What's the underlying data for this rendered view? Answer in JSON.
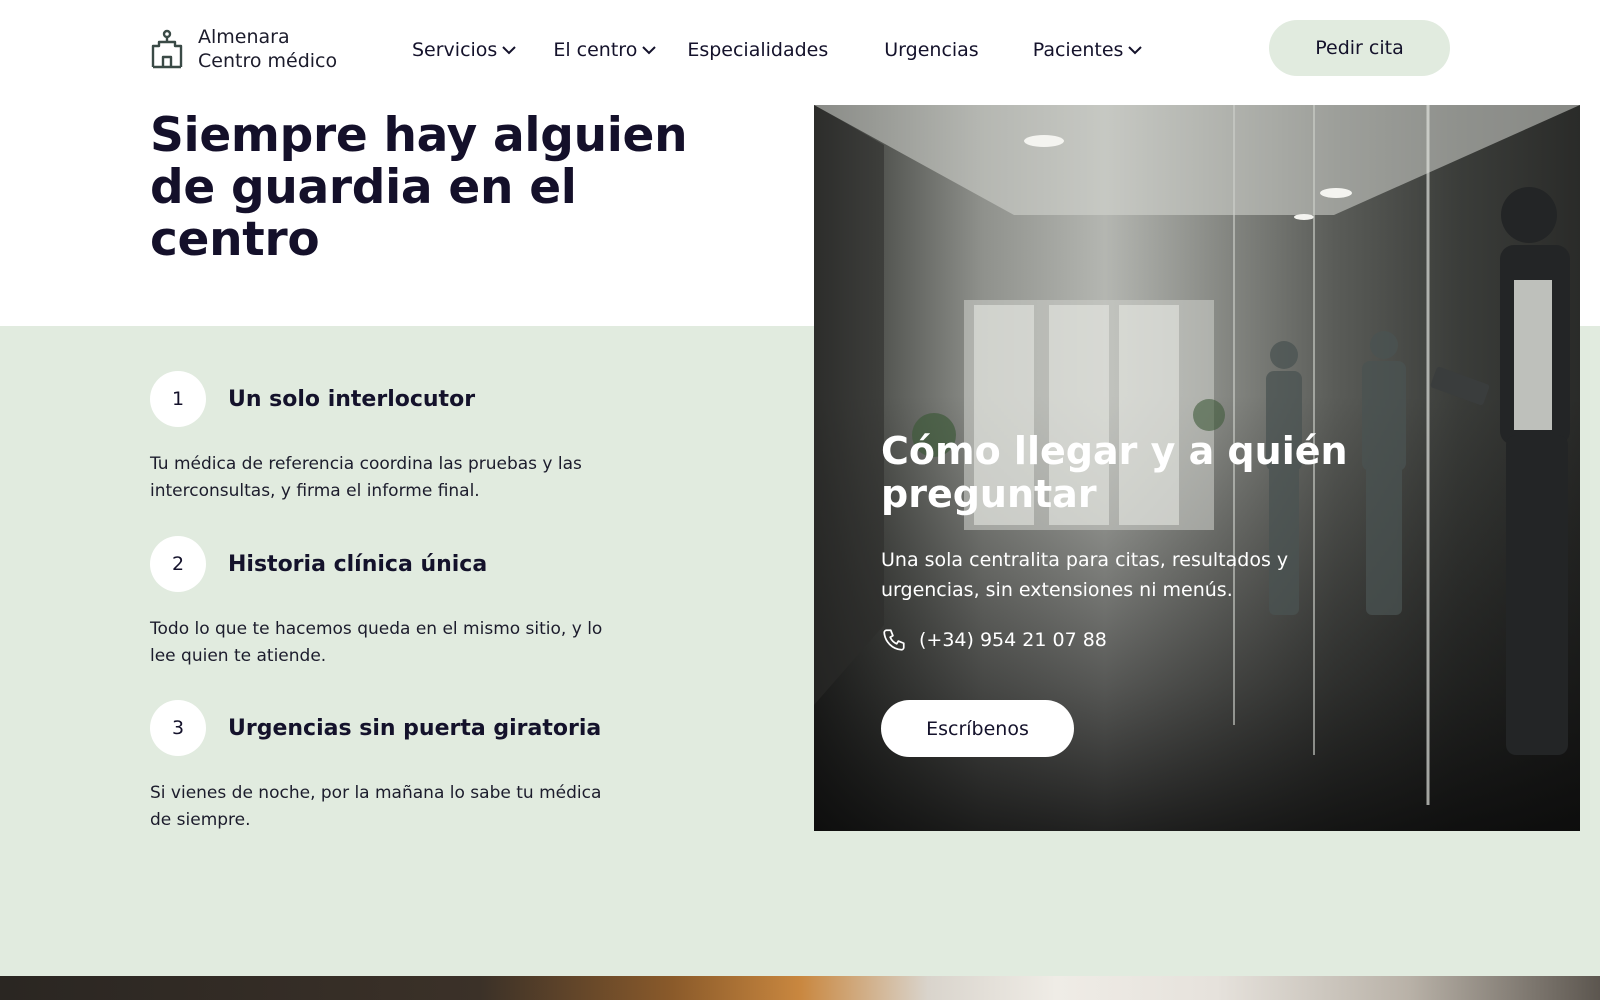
{
  "brand": {
    "name_line1": "Almenara",
    "name_line2": "Centro médico",
    "icon": "hospital-building-icon"
  },
  "nav": {
    "items": [
      {
        "label": "Servicios",
        "has_dropdown": true
      },
      {
        "label": "El centro",
        "has_dropdown": true
      },
      {
        "label": "Especialidades",
        "has_dropdown": false
      },
      {
        "label": "Urgencias",
        "has_dropdown": false
      },
      {
        "label": "Pacientes",
        "has_dropdown": true
      }
    ],
    "cta_label": "Pedir cita"
  },
  "hero": {
    "title": "Siempre hay alguien de guardia en el centro"
  },
  "steps": [
    {
      "number": "1",
      "title": "Un solo interlocutor",
      "description": "Tu médica de referencia coordina las pruebas y las interconsultas, y firma el informe final."
    },
    {
      "number": "2",
      "title": "Historia clínica única",
      "description": "Todo lo que te hacemos queda en el mismo sitio, y lo lee quien te atiende."
    },
    {
      "number": "3",
      "title": "Urgencias sin puerta giratoria",
      "description": "Si vienes de noche, por la mañana lo sabe tu médica de siempre."
    }
  ],
  "contact_card": {
    "title": "Cómo llegar y a quién preguntar",
    "description": "Una sola centralita para citas, resultados y urgencias, sin extensiones ni menús.",
    "phone": "(+34) 954 21 07 88",
    "phone_icon": "phone-icon",
    "button_label": "Escríbenos"
  },
  "colors": {
    "accent_green": "#e1ebdf",
    "text_dark": "#14122b",
    "white": "#ffffff"
  }
}
